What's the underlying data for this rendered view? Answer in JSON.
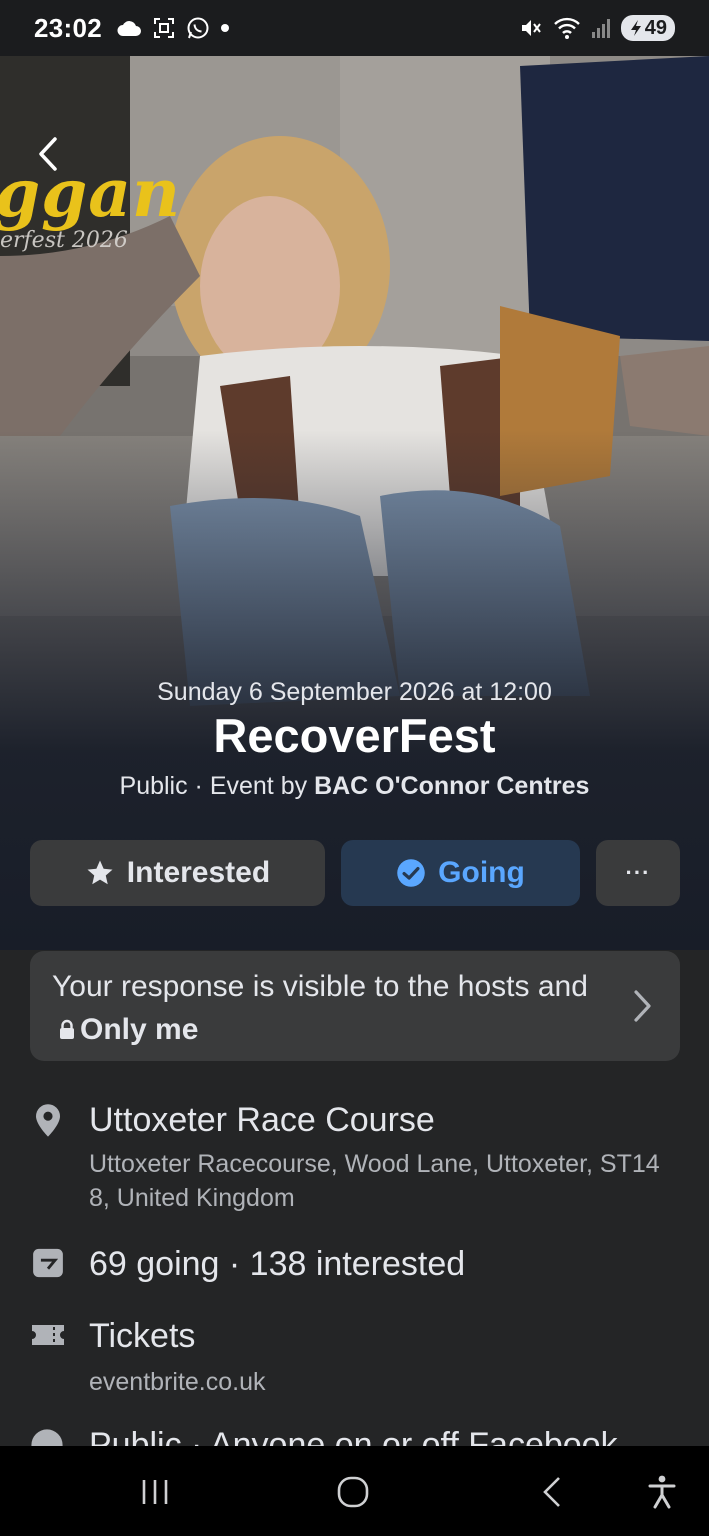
{
  "status_bar": {
    "time": "23:02",
    "battery": "49"
  },
  "cover": {
    "poster_line_1": "ggan",
    "poster_line_2": "erfest 2026"
  },
  "event": {
    "date": "Sunday 6 September 2026 at 12:00",
    "title": "RecoverFest",
    "privacy": "Public",
    "separator": " · ",
    "by_prefix": "Event by ",
    "host": "BAC O'Connor Centres"
  },
  "actions": {
    "interested_label": "Interested",
    "going_label": "Going",
    "more_label": "···"
  },
  "notice": {
    "text_1": "Your response is visible to the hosts and",
    "audience": "Only me"
  },
  "location": {
    "name": "Uttoxeter Race Course",
    "address": "Uttoxeter Racecourse, Wood Lane, Uttoxeter, ST14 8, United Kingdom"
  },
  "attendance": {
    "text": "69 going · 138 interested"
  },
  "tickets": {
    "label": "Tickets",
    "site": "eventbrite.co.uk"
  },
  "cutoff_row": {
    "text": "Public · Anyone on or off Facebook"
  },
  "colors": {
    "accent": "#5aa7ff",
    "going_bg": "#263951",
    "surface": "#3a3b3c",
    "background": "#242526"
  }
}
